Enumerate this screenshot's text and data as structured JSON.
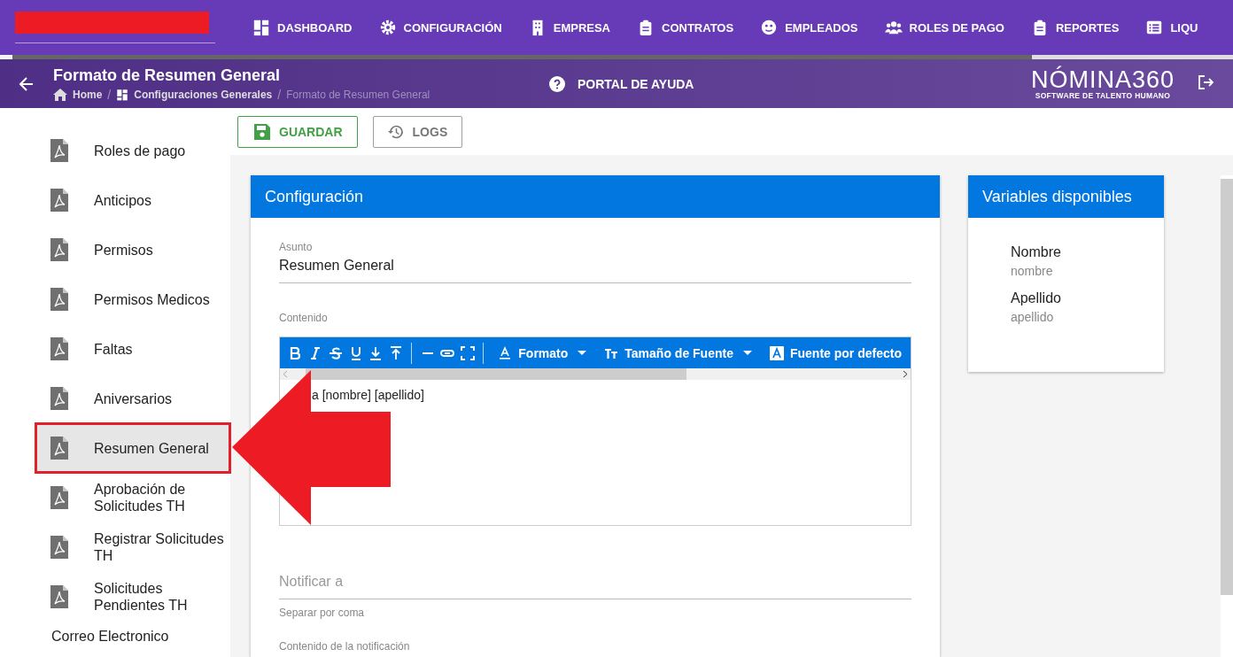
{
  "nav": {
    "items": [
      {
        "label": "DASHBOARD"
      },
      {
        "label": "CONFIGURACIÓN"
      },
      {
        "label": "EMPRESA"
      },
      {
        "label": "CONTRATOS"
      },
      {
        "label": "EMPLEADOS"
      },
      {
        "label": "ROLES DE PAGO"
      },
      {
        "label": "REPORTES"
      },
      {
        "label": "LIQU"
      }
    ]
  },
  "page_header": {
    "title": "Formato de Resumen General",
    "breadcrumbs": [
      {
        "label": "Home"
      },
      {
        "label": "Configuraciones Generales"
      },
      {
        "label": "Formato de Resumen General"
      }
    ],
    "breadcrumb_separator": "/",
    "help": "PORTAL DE AYUDA",
    "logo": {
      "name": "NÓMINA360",
      "tagline": "SOFTWARE DE TALENTO HUMANO"
    }
  },
  "sidebar": {
    "items": [
      {
        "label": "Roles de pago",
        "selected": false
      },
      {
        "label": "Anticipos",
        "selected": false
      },
      {
        "label": "Permisos",
        "selected": false
      },
      {
        "label": "Permisos Medicos",
        "selected": false
      },
      {
        "label": "Faltas",
        "selected": false
      },
      {
        "label": "Aniversarios",
        "selected": false
      },
      {
        "label": "Resumen General",
        "selected": true
      },
      {
        "label": "Aprobación de Solicitudes TH",
        "selected": false
      },
      {
        "label": "Registrar Solicitudes TH",
        "selected": false
      },
      {
        "label": "Solicitudes Pendientes TH",
        "selected": false
      }
    ],
    "section": "Correo Electronico"
  },
  "toolbar": {
    "save": "GUARDAR",
    "logs": "LOGS"
  },
  "config": {
    "title": "Configuración",
    "subject_label": "Asunto",
    "subject": "Resumen General",
    "content_label": "Contenido",
    "editor_tools": {
      "format": "Formato",
      "size": "Tamaño de Fuente",
      "font": "Fuente por defecto"
    },
    "editor_text": "a [nombre] [apellido]",
    "notify_placeholder": "Notificar a",
    "notify_hint": "Separar por coma",
    "notification_label": "Contenido de la notificación"
  },
  "variables": {
    "title": "Variables disponibles",
    "items": [
      {
        "name": "Nombre",
        "key": "nombre"
      },
      {
        "name": "Apellido",
        "key": "apellido"
      }
    ]
  }
}
